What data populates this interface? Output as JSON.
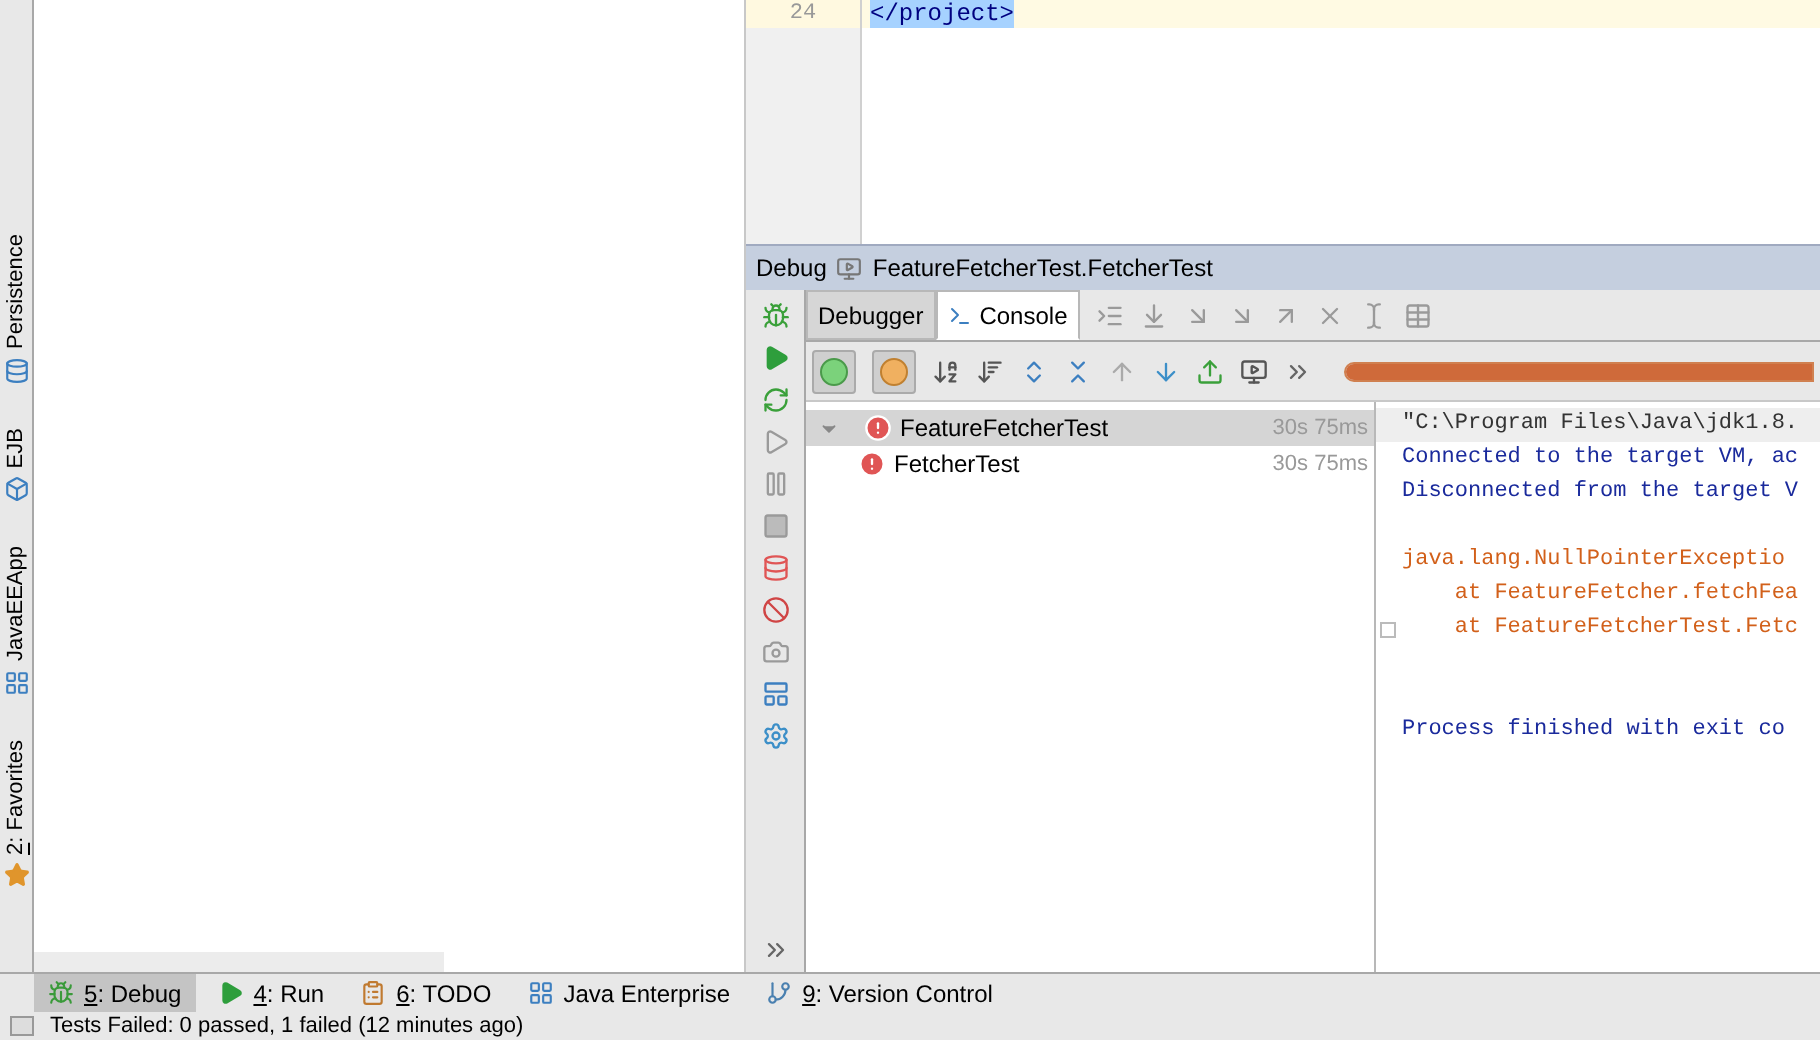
{
  "side_tabs": [
    {
      "label": "Persistence"
    },
    {
      "label": "EJB"
    },
    {
      "label": "JavaEEApp"
    },
    {
      "key": "2",
      "label": ": Favorites"
    }
  ],
  "editor": {
    "line_number": "24",
    "code": "</project>"
  },
  "debug_panel": {
    "title": "Debug",
    "config": "FeatureFetcherTest.FetcherTest",
    "tabs": [
      {
        "label": "Debugger",
        "selected": false
      },
      {
        "label": "Console",
        "selected": true
      }
    ],
    "progress": {
      "level": 1
    },
    "tree": [
      {
        "name": "FeatureFetcherTest",
        "time": "30s 75ms",
        "failed": true,
        "selected": true,
        "expanded": true,
        "children": [
          {
            "name": "FetcherTest",
            "time": "30s 75ms",
            "failed": true,
            "selected": false
          }
        ]
      }
    ],
    "console": [
      {
        "kind": "command",
        "text": "\"C:\\Program Files\\Java\\jdk1.8."
      },
      {
        "kind": "info",
        "text": "Connected to the target VM, ac"
      },
      {
        "kind": "info",
        "text": "Disconnected from the target V"
      },
      {
        "kind": "error",
        "text": "java.lang.NullPointerExceptio"
      },
      {
        "kind": "trace",
        "text": "    at FeatureFetcher.fetchFea"
      },
      {
        "kind": "trace",
        "text": "    at FeatureFetcherTest.Fetc",
        "foldable": true
      },
      {
        "kind": "exit",
        "text": "Process finished with exit co"
      }
    ]
  },
  "tool_buttons": [
    {
      "key": "5",
      "label": ": Debug",
      "selected": true
    },
    {
      "key": "4",
      "label": ": Run",
      "selected": false
    },
    {
      "key": "6",
      "label": ": TODO",
      "selected": false
    },
    {
      "label": "Java Enterprise",
      "selected": false
    },
    {
      "key": "9",
      "label": ": Version Control",
      "selected": false
    }
  ],
  "status_bar": {
    "text": "Tests Failed: 0 passed, 1 failed (12 minutes ago)"
  }
}
